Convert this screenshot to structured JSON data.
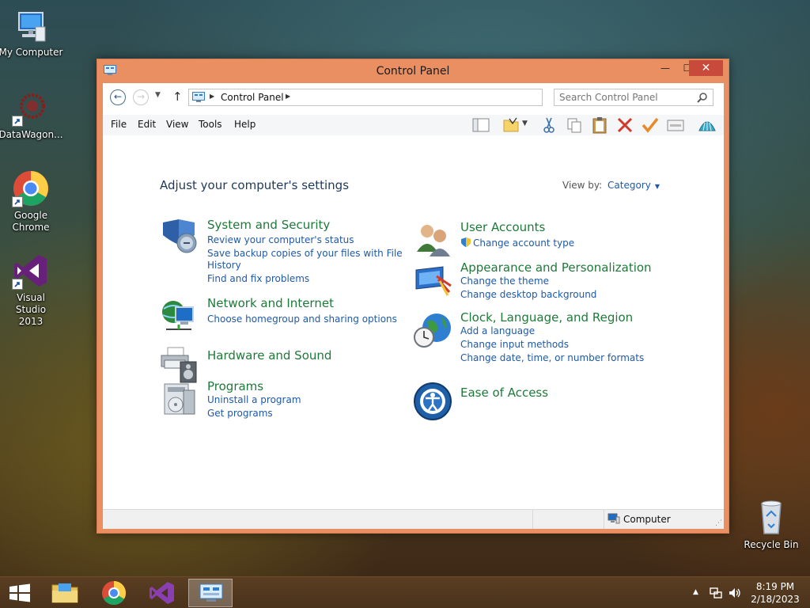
{
  "desktop": {
    "icons": [
      {
        "label": "My Computer"
      },
      {
        "label": "DataWagon..."
      },
      {
        "label": "Google Chrome"
      },
      {
        "label": "Visual Studio 2013"
      },
      {
        "label": "Recycle Bin"
      }
    ]
  },
  "window": {
    "title": "Control Panel",
    "accent_color": "#e98f62",
    "close_color": "#c74a3a",
    "minimize_label": "—",
    "maximize_label": "☐",
    "close_label": "✕"
  },
  "address": {
    "location": "Control Panel",
    "search_placeholder": "Search Control Panel"
  },
  "menu": {
    "items": [
      "File",
      "Edit",
      "View",
      "Tools",
      "Help"
    ]
  },
  "content": {
    "heading": "Adjust your computer's settings",
    "view_by_label": "View by:",
    "view_by_value": "Category",
    "left_categories": [
      {
        "title": "System and Security",
        "icon": "shield-icon",
        "links": [
          "Review your computer's status",
          "Save backup copies of your files with File",
          "History",
          "Find and fix problems"
        ]
      },
      {
        "title": "Network and Internet",
        "icon": "network-icon",
        "links": [
          "Choose homegroup and sharing options"
        ]
      },
      {
        "title": "Hardware and Sound",
        "icon": "printer-speaker-icon",
        "links": []
      },
      {
        "title": "Programs",
        "icon": "programs-icon",
        "links": [
          "Uninstall a program",
          "Get programs"
        ]
      }
    ],
    "right_categories": [
      {
        "title": "User Accounts",
        "icon": "users-icon",
        "links": [
          "Change account type"
        ]
      },
      {
        "title": "Appearance and Personalization",
        "icon": "display-icon",
        "links": [
          "Change the theme",
          "Change desktop background"
        ]
      },
      {
        "title": "Clock, Language, and Region",
        "icon": "globe-clock-icon",
        "links": [
          "Add a language",
          "Change input methods",
          "Change date, time, or number formats"
        ]
      },
      {
        "title": "Ease of Access",
        "icon": "ease-of-access-icon",
        "links": []
      }
    ],
    "title_color": "#1e7a39",
    "link_color": "#1e5aa8"
  },
  "status": {
    "location": "Computer"
  },
  "taskbar": {
    "time": "8:19 PM",
    "date": "2/18/2023",
    "tray_chevron": "▲"
  }
}
